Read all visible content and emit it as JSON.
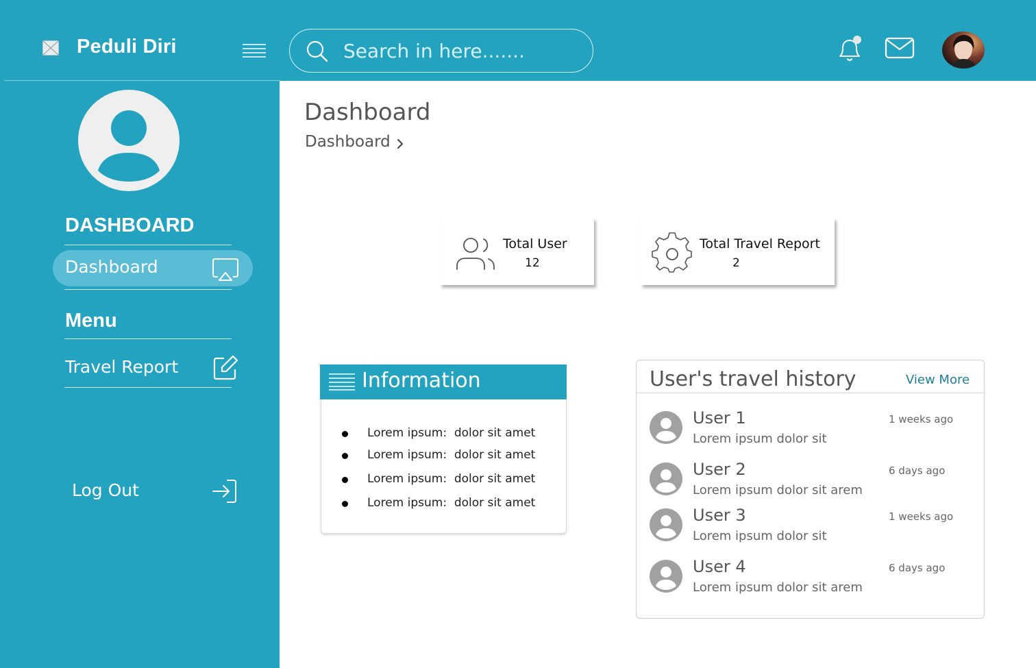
{
  "brand": {
    "name": "Peduli Diri",
    "logo_icon": "image-placeholder-icon"
  },
  "topbar": {
    "menu_icon": "hamburger-icon",
    "search": {
      "placeholder": "Search in here.......",
      "icon": "search-icon"
    },
    "notification_icon": "bell-icon",
    "mail_icon": "mail-icon",
    "avatar": "user-photo"
  },
  "sidebar": {
    "profile_icon": "profile-avatar-icon",
    "section_dashboard": "DASHBOARD",
    "dashboard_item": {
      "label": "Dashboard",
      "icon": "airplay-icon"
    },
    "section_menu": "Menu",
    "travel_item": {
      "label": "Travel Report",
      "icon": "edit-icon"
    },
    "logout": {
      "label": "Log Out",
      "icon": "logout-icon"
    }
  },
  "main": {
    "title": "Dashboard",
    "breadcrumb": "Dashboard",
    "stats": [
      {
        "title": "Total User",
        "value": "12",
        "icon": "users-icon"
      },
      {
        "title": "Total Travel Report",
        "value": "2",
        "icon": "gear-icon"
      }
    ],
    "information": {
      "title": "Information",
      "items": [
        "Lorem ipsum:  dolor sit amet",
        "Lorem ipsum:  dolor sit amet",
        "Lorem ipsum:  dolor sit amet",
        "Lorem ipsum:  dolor sit amet"
      ]
    },
    "history": {
      "title": "User's travel history",
      "view_more": "View More",
      "items": [
        {
          "name": "User 1",
          "desc": "Lorem ipsum dolor sit",
          "time": "1 weeks ago"
        },
        {
          "name": "User 2",
          "desc": "Lorem ipsum dolor sit arem",
          "time": "6 days ago"
        },
        {
          "name": "User 3",
          "desc": "Lorem ipsum dolor sit",
          "time": "1 weeks ago"
        },
        {
          "name": "User 4",
          "desc": "Lorem ipsum dolor sit arem",
          "time": "6 days ago"
        }
      ]
    }
  },
  "colors": {
    "primary": "#23a3c0",
    "active_item": "#5bbdd5",
    "link": "#1f7f96"
  }
}
